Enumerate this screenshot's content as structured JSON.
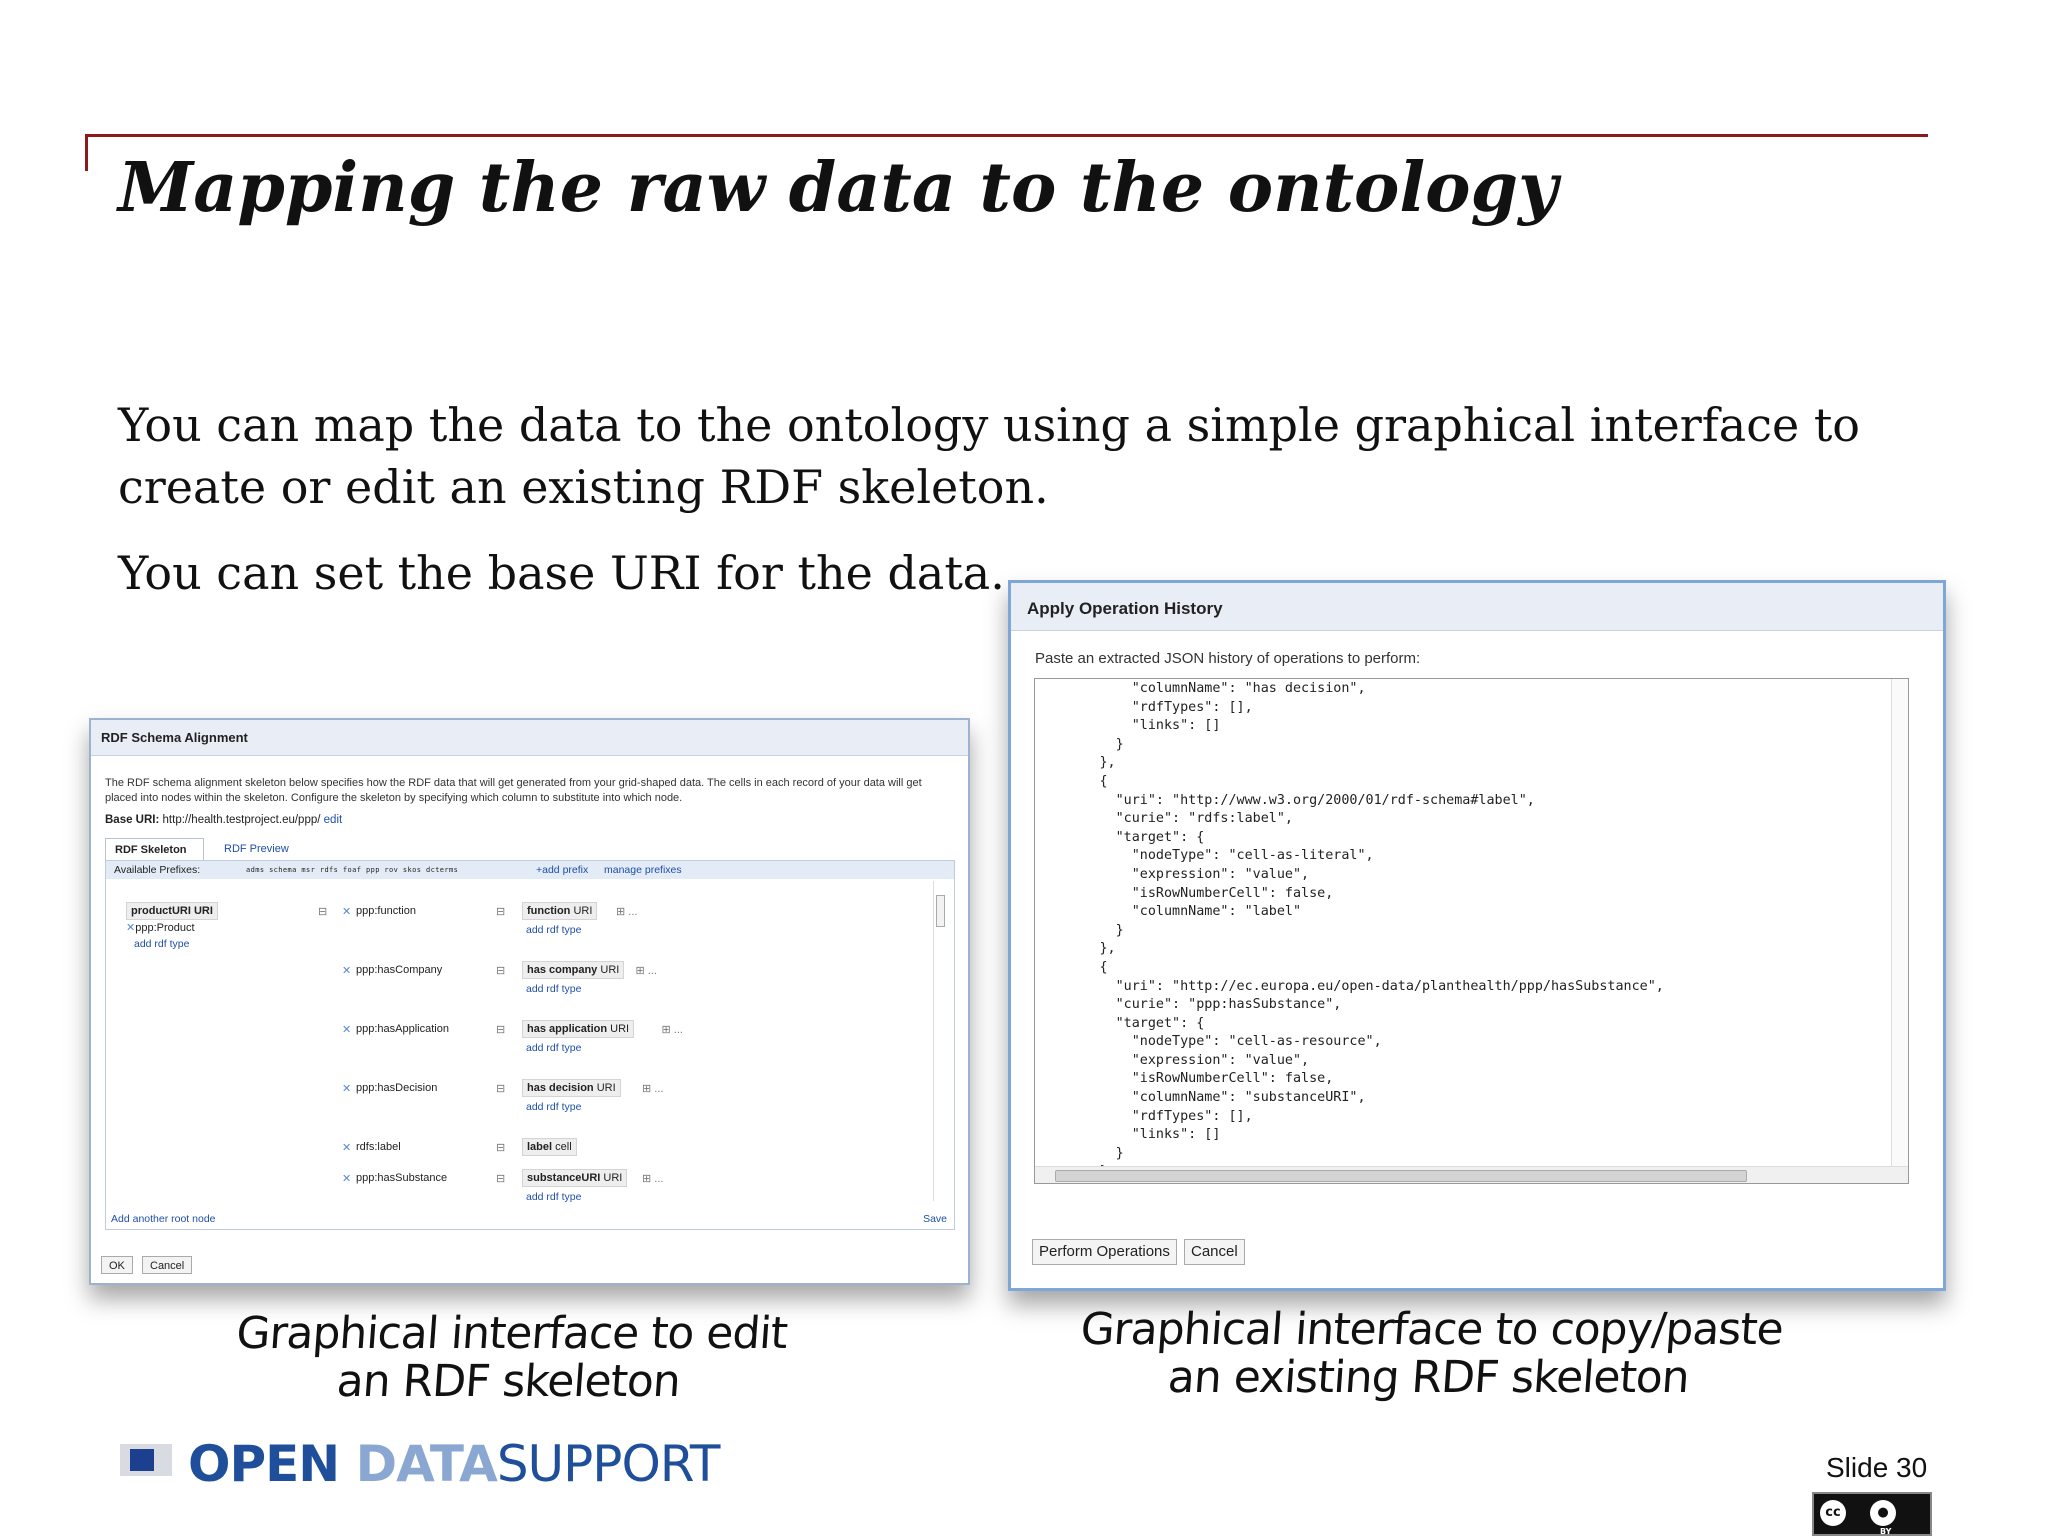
{
  "slide": {
    "title": "Mapping the raw data to the ontology",
    "para1_line1": "You can map the data to the ontology using a simple graphical interface to",
    "para1_line2": "create or edit an existing RDF skeleton.",
    "para2": "You can set the base URI for the data.",
    "caption_left_1": "Graphical interface to edit",
    "caption_left_2": "an RDF skeleton",
    "caption_right_1": "Graphical interface to copy/paste",
    "caption_right_2": "an existing RDF skeleton",
    "slide_number": "Slide 30",
    "logo_open": "OPEN ",
    "logo_data": "DATA",
    "logo_support": "SUPPORT",
    "license": "cc BY"
  },
  "rdf_dialog": {
    "title": "RDF Schema Alignment",
    "description": "The RDF schema alignment skeleton below specifies how the RDF data that will get generated from your grid-shaped data. The cells in each record of your data will get placed into nodes within the skeleton. Configure the skeleton by specifying which column to substitute into which node.",
    "base_uri_label": "Base URI:",
    "base_uri_value": "http://health.testproject.eu/ppp/",
    "edit_link": "edit",
    "tab_skeleton": "RDF Skeleton",
    "tab_preview": "RDF Preview",
    "prefixes_label": "Available Prefixes:",
    "prefixes": "adms schema msr rdfs foaf ppp rov skos dcterms",
    "add_prefix": "+add prefix",
    "manage_prefixes": "manage prefixes",
    "root_node": "productURI URI",
    "root_type": "ppp:Product",
    "add_rdf_type": "add rdf type",
    "properties": [
      {
        "property": "ppp:function",
        "target": "function",
        "target_suffix": " URI",
        "has_type": true
      },
      {
        "property": "ppp:hasCompany",
        "target": "has company",
        "target_suffix": " URI",
        "has_type": true
      },
      {
        "property": "ppp:hasApplication",
        "target": "has application",
        "target_suffix": " URI",
        "has_type": true
      },
      {
        "property": "ppp:hasDecision",
        "target": "has decision",
        "target_suffix": " URI",
        "has_type": true
      },
      {
        "property": "rdfs:label",
        "target": "label",
        "target_suffix": " cell",
        "has_type": false
      },
      {
        "property": "ppp:hasSubstance",
        "target": "substanceURI",
        "target_suffix": " URI",
        "has_type": true
      }
    ],
    "add_root_node": "Add another root node",
    "save": "Save",
    "ok": "OK",
    "cancel": "Cancel"
  },
  "history_dialog": {
    "title": "Apply Operation History",
    "prompt": "Paste an extracted JSON history of operations to perform:",
    "json_text": "            \"columnName\": \"has decision\",\n            \"rdfTypes\": [],\n            \"links\": []\n          }\n        },\n        {\n          \"uri\": \"http://www.w3.org/2000/01/rdf-schema#label\",\n          \"curie\": \"rdfs:label\",\n          \"target\": {\n            \"nodeType\": \"cell-as-literal\",\n            \"expression\": \"value\",\n            \"isRowNumberCell\": false,\n            \"columnName\": \"label\"\n          }\n        },\n        {\n          \"uri\": \"http://ec.europa.eu/open-data/planthealth/ppp/hasSubstance\",\n          \"curie\": \"ppp:hasSubstance\",\n          \"target\": {\n            \"nodeType\": \"cell-as-resource\",\n            \"expression\": \"value\",\n            \"isRowNumberCell\": false,\n            \"columnName\": \"substanceURI\",\n            \"rdfTypes\": [],\n            \"links\": []\n          }\n        },",
    "perform": "Perform Operations",
    "cancel": "Cancel"
  }
}
